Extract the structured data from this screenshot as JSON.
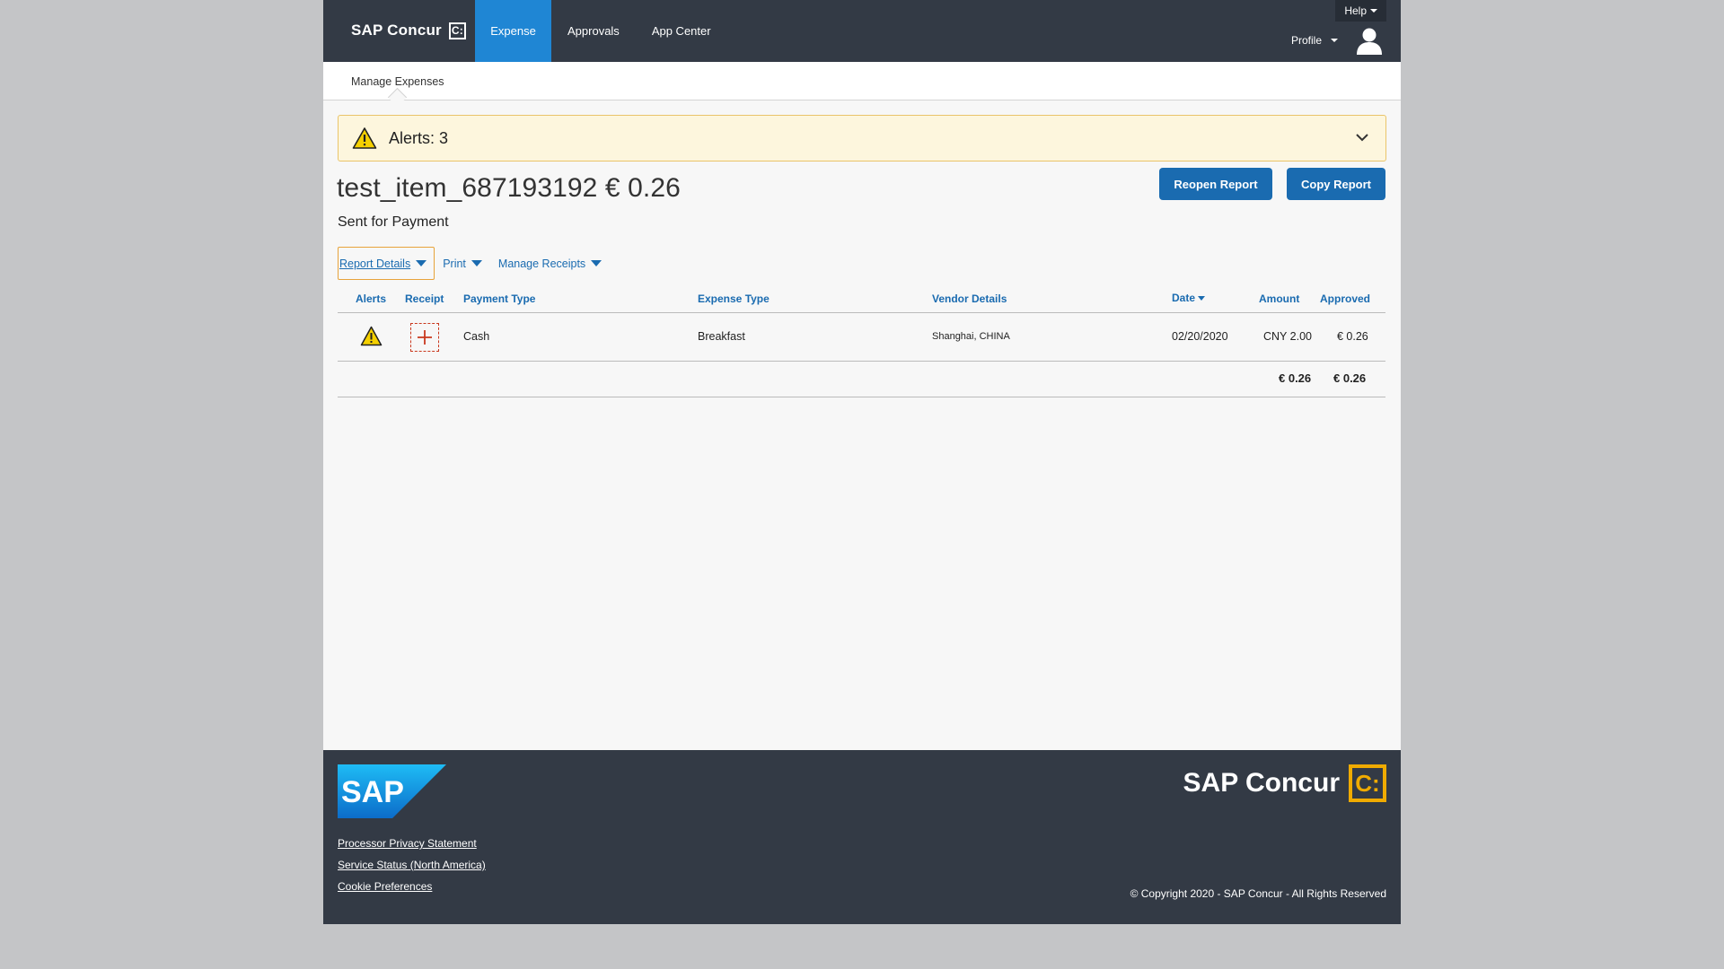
{
  "topbar": {
    "brand": "SAP Concur",
    "brand_mark": "C:",
    "nav": [
      {
        "label": "Expense",
        "active": true
      },
      {
        "label": "Approvals",
        "active": false
      },
      {
        "label": "App Center",
        "active": false
      }
    ],
    "help_label": "Help",
    "profile_label": "Profile",
    "avatar_icon": "user-avatar-icon"
  },
  "subbar": {
    "item": "Manage Expenses"
  },
  "alerts": {
    "label": "Alerts: 3",
    "icon": "warning-icon"
  },
  "report": {
    "title": "test_item_687193192 € 0.26",
    "status": "Sent for Payment",
    "reopen_label": "Reopen Report",
    "copy_label": "Copy Report"
  },
  "toolbar": {
    "report_details": "Report Details",
    "print": "Print",
    "manage_receipts": "Manage Receipts"
  },
  "table": {
    "headers": {
      "alerts": "Alerts",
      "receipt": "Receipt",
      "payment_type": "Payment Type",
      "expense_type": "Expense Type",
      "vendor_details": "Vendor Details",
      "date": "Date",
      "amount": "Amount",
      "approved": "Approved"
    },
    "rows": [
      {
        "payment_type": "Cash",
        "expense_type": "Breakfast",
        "vendor_details": "Shanghai, CHINA",
        "date": "02/20/2020",
        "amount": "CNY 2.00",
        "approved": "€ 0.26"
      }
    ],
    "totals": {
      "amount": "€ 0.26",
      "approved": "€ 0.26"
    }
  },
  "footer": {
    "sap_logo_text": "SAP",
    "links": [
      "Processor Privacy Statement",
      "Service Status (North America)",
      "Cookie Preferences"
    ],
    "brand": "SAP Concur",
    "brand_mark": "C:",
    "copyright": "© Copyright 2020 - SAP Concur - All Rights Reserved"
  },
  "colors": {
    "nav_bg": "#333a45",
    "active_tab": "#1f86d4",
    "link_blue": "#1a6bb0",
    "alert_bg": "#fdf6dd",
    "footer_accent": "#f0ab00"
  }
}
